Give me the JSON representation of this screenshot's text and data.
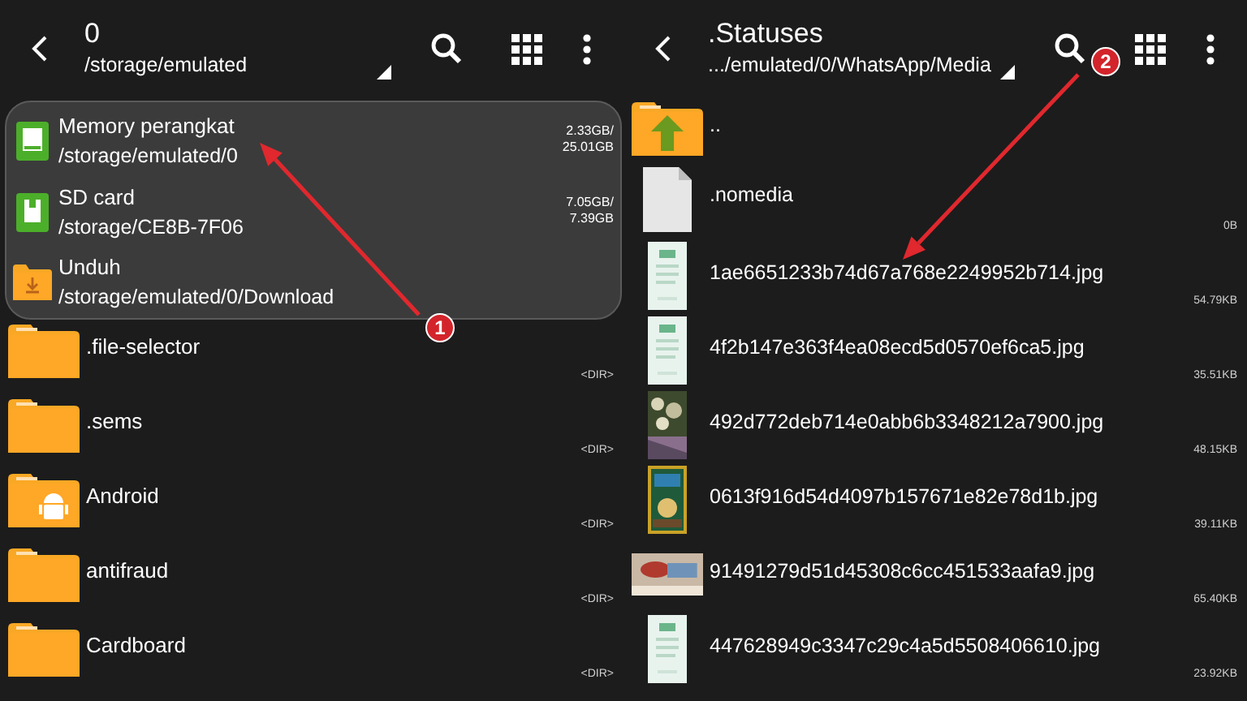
{
  "left": {
    "title": "0",
    "path": "/storage/emulated",
    "storage_menu": [
      {
        "kind": "internal",
        "name": "Memory perangkat",
        "path": "/storage/emulated/0",
        "used": "2.33GB/",
        "total": "25.01GB"
      },
      {
        "kind": "sdcard",
        "name": "SD card",
        "path": "/storage/CE8B-7F06",
        "used": "7.05GB/",
        "total": "7.39GB"
      },
      {
        "kind": "download",
        "name": "Unduh",
        "path": "/storage/emulated/0/Download"
      }
    ],
    "items": [
      {
        "kind": "folder",
        "name": ".file-selector",
        "size": "<DIR>"
      },
      {
        "kind": "folder",
        "name": ".sems",
        "size": "<DIR>"
      },
      {
        "kind": "android",
        "name": "Android",
        "size": "<DIR>"
      },
      {
        "kind": "folder",
        "name": "antifraud",
        "size": "<DIR>"
      },
      {
        "kind": "folder",
        "name": "Cardboard",
        "size": "<DIR>"
      }
    ]
  },
  "right": {
    "title": ".Statuses",
    "path": ".../emulated/0/WhatsApp/Media",
    "items": [
      {
        "kind": "parent",
        "name": ".."
      },
      {
        "kind": "file",
        "name": ".nomedia",
        "size": "0B"
      },
      {
        "name": "1ae6651233b74d67a768e2249952b714.jpg",
        "size": "54.79KB"
      },
      {
        "name": "4f2b147e363f4ea08ecd5d0570ef6ca5.jpg",
        "size": "35.51KB"
      },
      {
        "name": "492d772deb714e0abb6b3348212a7900.jpg",
        "size": "48.15KB"
      },
      {
        "name": "0613f916d54d4097b157671e82e78d1b.jpg",
        "size": "39.11KB"
      },
      {
        "name": "91491279d51d45308c6cc451533aafa9.jpg",
        "size": "65.40KB"
      },
      {
        "name": "447628949c3347c29c4a5d5508406610.jpg",
        "size": "23.92KB"
      }
    ]
  },
  "annotations": [
    {
      "label": "1"
    },
    {
      "label": "2"
    }
  ]
}
